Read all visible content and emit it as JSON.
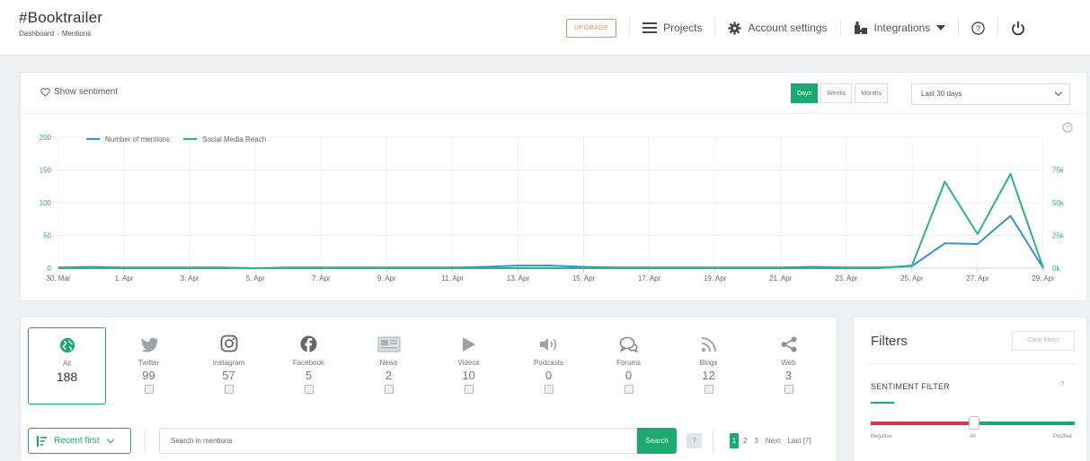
{
  "header": {
    "title": "#Booktrailer",
    "breadcrumb": [
      "Dashboard",
      "Mentions"
    ],
    "upgrade_label": "UPGRADE",
    "projects_label": "Projects",
    "account_label": "Account settings",
    "integrations_label": "Integrations"
  },
  "chart_panel": {
    "show_sentiment_label": "Show sentiment",
    "range_buttons": [
      "Days",
      "Weeks",
      "Months"
    ],
    "active_range": "Days",
    "period_select": "Last 30 days"
  },
  "chart_data": {
    "type": "line",
    "x": [
      "30. Mar",
      "31. Mar",
      "1. Apr",
      "2. Apr",
      "3. Apr",
      "4. Apr",
      "5. Apr",
      "6. Apr",
      "7. Apr",
      "8. Apr",
      "9. Apr",
      "10. Apr",
      "11. Apr",
      "12. Apr",
      "13. Apr",
      "14. Apr",
      "15. Apr",
      "16. Apr",
      "17. Apr",
      "18. Apr",
      "19. Apr",
      "20. Apr",
      "21. Apr",
      "22. Apr",
      "23. Apr",
      "24. Apr",
      "25. Apr",
      "26. Apr",
      "27. Apr",
      "28. Apr",
      "29. Apr"
    ],
    "x_tick_labels": [
      "30. Mar",
      "1. Apr",
      "3. Apr",
      "5. Apr",
      "7. Apr",
      "9. Apr",
      "11. Apr",
      "13. Apr",
      "15. Apr",
      "17. Apr",
      "19. Apr",
      "21. Apr",
      "23. Apr",
      "25. Apr",
      "27. Apr",
      "29. Apr"
    ],
    "y_left_ticks": [
      "0",
      "50",
      "100",
      "150",
      "200"
    ],
    "y_left_range": [
      0,
      200
    ],
    "y_right_ticks": [
      "0k",
      "25k",
      "50k",
      "75k"
    ],
    "y_right_range": [
      0,
      100000
    ],
    "series": [
      {
        "name": "Number of mentions",
        "axis": "left",
        "color": "#3a8fd9",
        "values": [
          1,
          2,
          1,
          1,
          1,
          1,
          0,
          1,
          1,
          1,
          1,
          1,
          1,
          2,
          4,
          4,
          2,
          1,
          1,
          1,
          1,
          1,
          1,
          2,
          1,
          1,
          3,
          38,
          37,
          80,
          0
        ]
      },
      {
        "name": "Social Media Reach",
        "axis": "right",
        "color": "#2ab487",
        "values": [
          0,
          0,
          0,
          0,
          0,
          0,
          0,
          0,
          0,
          0,
          0,
          0,
          0,
          0,
          0,
          0,
          0,
          0,
          0,
          0,
          0,
          0,
          0,
          0,
          0,
          0,
          2000,
          66000,
          26000,
          72000,
          0
        ]
      }
    ],
    "grid": true,
    "legend": "top-left"
  },
  "sources": [
    {
      "label": "All",
      "count": "188",
      "icon": "globe-icon",
      "active": true
    },
    {
      "label": "Twitter",
      "count": "99",
      "icon": "twitter-icon"
    },
    {
      "label": "Instagram",
      "count": "57",
      "icon": "instagram-icon"
    },
    {
      "label": "Facebook",
      "count": "5",
      "icon": "facebook-icon"
    },
    {
      "label": "News",
      "count": "2",
      "icon": "news-icon"
    },
    {
      "label": "Videos",
      "count": "10",
      "icon": "video-icon"
    },
    {
      "label": "Podcasts",
      "count": "0",
      "icon": "podcast-icon"
    },
    {
      "label": "Forums",
      "count": "0",
      "icon": "forum-icon"
    },
    {
      "label": "Blogs",
      "count": "12",
      "icon": "rss-icon"
    },
    {
      "label": "Web",
      "count": "3",
      "icon": "share-icon"
    }
  ],
  "toolbar": {
    "sort_label": "Recent first",
    "search_placeholder": "Search in mentions",
    "search_button": "Search",
    "help": "?",
    "pages": [
      "1",
      "2",
      "3"
    ],
    "next_label": "Next",
    "last_label": "Last [7]"
  },
  "filters": {
    "title": "Filters",
    "clear_label": "Clear filters",
    "sentiment_title": "SENTIMENT FILTER",
    "help": "?",
    "slider_labels": [
      "Negative",
      "All",
      "Positive"
    ]
  },
  "colors": {
    "accent": "#1ba96f",
    "upgrade": "#f08a4b",
    "negative": "#d9354a"
  }
}
